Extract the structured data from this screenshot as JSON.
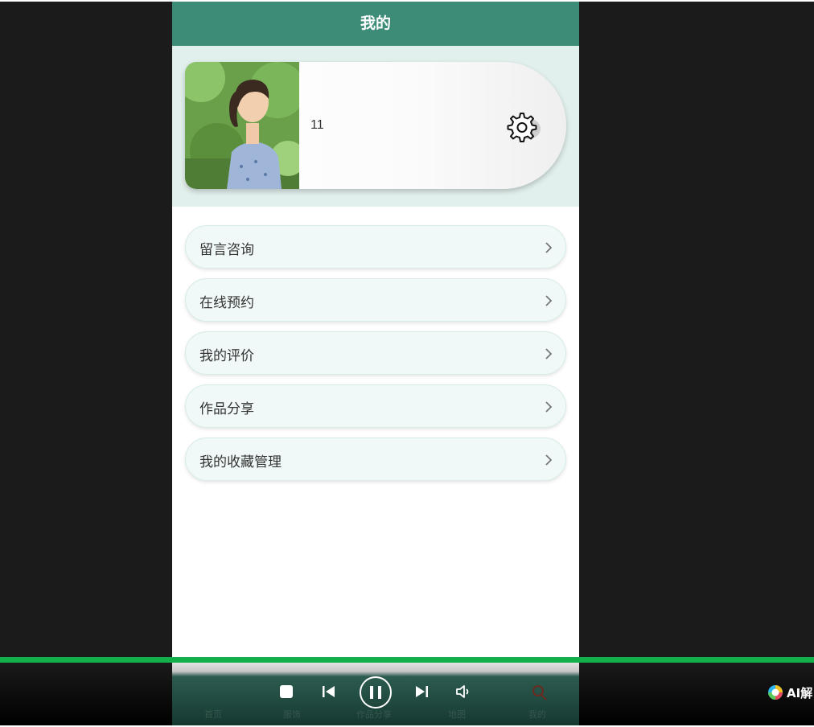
{
  "header": {
    "title": "我的"
  },
  "profile": {
    "username": "11"
  },
  "menu": {
    "items": [
      {
        "label": "留言咨询"
      },
      {
        "label": "在线预约"
      },
      {
        "label": "我的评价"
      },
      {
        "label": "作品分享"
      },
      {
        "label": "我的收藏管理"
      }
    ]
  },
  "tabbar": {
    "items": [
      {
        "label": "首页"
      },
      {
        "label": "服饰"
      },
      {
        "label": "作品分享"
      },
      {
        "label": "地图"
      },
      {
        "label": "我的"
      }
    ]
  },
  "player": {
    "ai_label": "AI解",
    "progress": 1.0
  },
  "colors": {
    "header": "#3d8c78",
    "progress": "#12b04b",
    "menu_bg": "#f0f9f7"
  }
}
